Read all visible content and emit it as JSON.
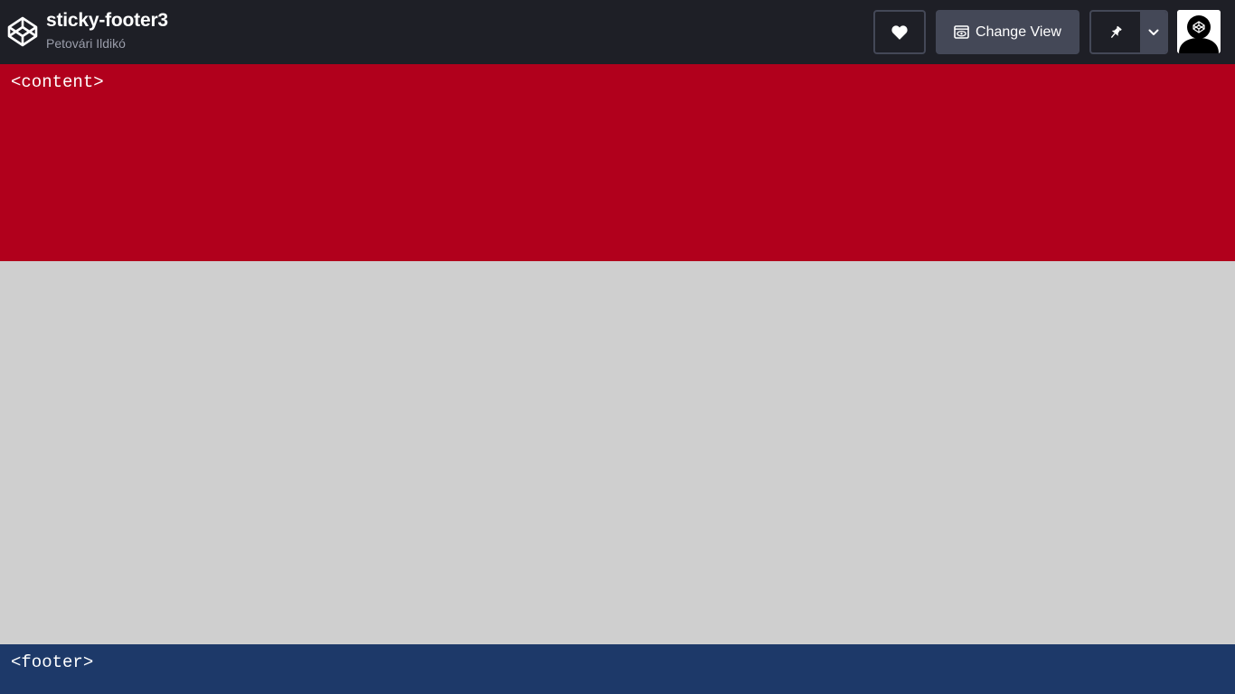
{
  "header": {
    "title": "sticky-footer3",
    "author": "Petovári Ildikó",
    "logo_icon": "codepen-logo-icon",
    "buttons": {
      "heart_icon": "heart-icon",
      "change_view_label": "Change View",
      "change_view_icon": "eye-window-icon",
      "pin_icon": "pin-icon",
      "dropdown_icon": "chevron-down-icon"
    },
    "avatar_icon": "user-avatar"
  },
  "preview": {
    "content_label": "<content>",
    "footer_label": "<footer>"
  },
  "colors": {
    "topbar_bg": "#1e1f26",
    "button_bg": "#444857",
    "content_bg": "#b1001c",
    "page_bg": "#cfcfcf",
    "footer_bg": "#1d3969"
  }
}
